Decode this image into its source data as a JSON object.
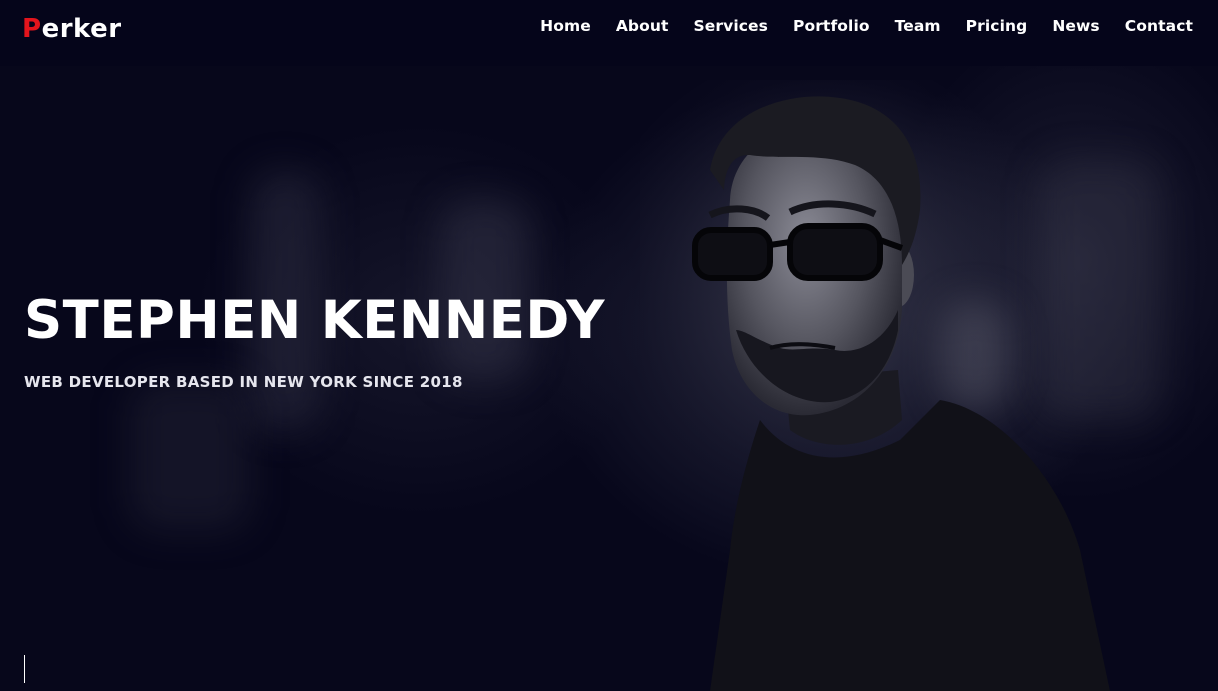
{
  "brand": {
    "first_letter": "P",
    "rest": "erker",
    "accent_color": "#e3141c"
  },
  "nav": {
    "items": [
      {
        "label": "Home"
      },
      {
        "label": "About"
      },
      {
        "label": "Services"
      },
      {
        "label": "Portfolio"
      },
      {
        "label": "Team"
      },
      {
        "label": "Pricing"
      },
      {
        "label": "News"
      },
      {
        "label": "Contact"
      }
    ]
  },
  "hero": {
    "title": "STEPHEN KENNEDY",
    "subtitle": "WEB DEVELOPER BASED IN NEW YORK SINCE 2018",
    "background_color": "#06061a"
  }
}
